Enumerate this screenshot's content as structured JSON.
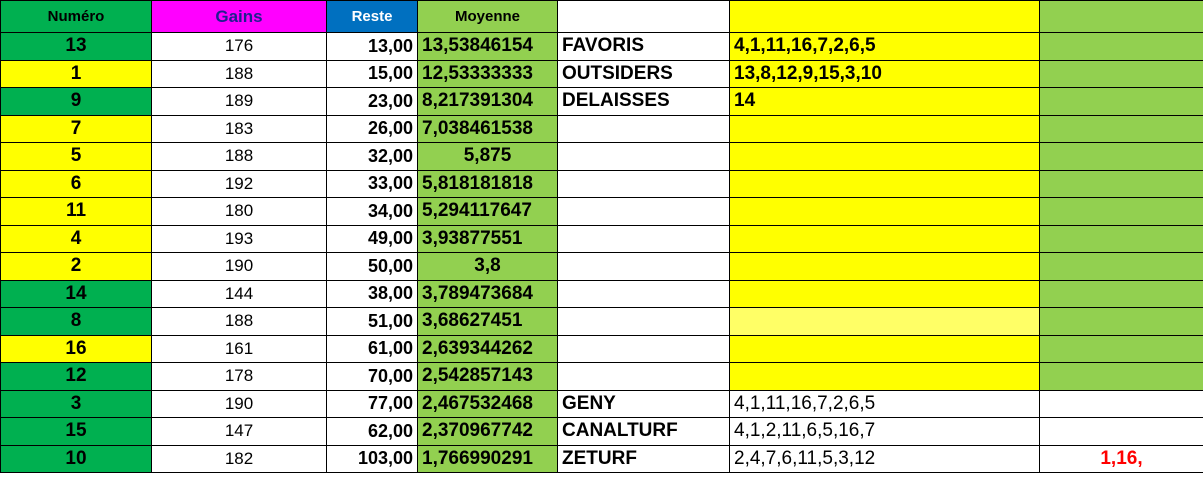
{
  "headers": {
    "numero": "Numéro",
    "gains": "Gains",
    "reste": "Reste",
    "moyenne": "Moyenne"
  },
  "rows": [
    {
      "numero": "13",
      "gains": "176",
      "reste": "13,00",
      "moyenne": "13,53846154",
      "label": "FAVORIS",
      "value": "4,1,11,16,7,2,6,5",
      "last": ""
    },
    {
      "numero": "1",
      "gains": "188",
      "reste": "15,00",
      "moyenne": "12,53333333",
      "label": "OUTSIDERS",
      "value": "13,8,12,9,15,3,10",
      "last": ""
    },
    {
      "numero": "9",
      "gains": "189",
      "reste": "23,00",
      "moyenne": "8,217391304",
      "label": "DELAISSES",
      "value": "14",
      "last": ""
    },
    {
      "numero": "7",
      "gains": "183",
      "reste": "26,00",
      "moyenne": "7,038461538",
      "label": "",
      "value": "",
      "last": ""
    },
    {
      "numero": "5",
      "gains": "188",
      "reste": "32,00",
      "moyenne": "5,875",
      "label": "",
      "value": "",
      "last": ""
    },
    {
      "numero": "6",
      "gains": "192",
      "reste": "33,00",
      "moyenne": "5,818181818",
      "label": "",
      "value": "",
      "last": ""
    },
    {
      "numero": "11",
      "gains": "180",
      "reste": "34,00",
      "moyenne": "5,294117647",
      "label": "",
      "value": "",
      "last": ""
    },
    {
      "numero": "4",
      "gains": "193",
      "reste": "49,00",
      "moyenne": "3,93877551",
      "label": "",
      "value": "",
      "last": ""
    },
    {
      "numero": "2",
      "gains": "190",
      "reste": "50,00",
      "moyenne": "3,8",
      "label": "",
      "value": "",
      "last": ""
    },
    {
      "numero": "14",
      "gains": "144",
      "reste": "38,00",
      "moyenne": "3,789473684",
      "label": "",
      "value": "",
      "last": ""
    },
    {
      "numero": "8",
      "gains": "188",
      "reste": "51,00",
      "moyenne": "3,68627451",
      "label": "",
      "value": "",
      "last": ""
    },
    {
      "numero": "16",
      "gains": "161",
      "reste": "61,00",
      "moyenne": "2,639344262",
      "label": "",
      "value": "",
      "last": ""
    },
    {
      "numero": "12",
      "gains": "178",
      "reste": "70,00",
      "moyenne": "2,542857143",
      "label": "",
      "value": "",
      "last": ""
    },
    {
      "numero": "3",
      "gains": "190",
      "reste": "77,00",
      "moyenne": "2,467532468",
      "label": "GENY",
      "value": "4,1,11,16,7,2,6,5",
      "last": ""
    },
    {
      "numero": "15",
      "gains": "147",
      "reste": "62,00",
      "moyenne": "2,370967742",
      "label": "CANALTURF",
      "value": "4,1,2,11,6,5,16,7",
      "last": ""
    },
    {
      "numero": "10",
      "gains": "182",
      "reste": "103,00",
      "moyenne": "1,766990291",
      "label": "ZETURF",
      "value": "2,4,7,6,11,5,3,12",
      "last": "1,16,"
    }
  ],
  "colors": {
    "green": "#00b050",
    "yellow": "#ffff00",
    "light_green": "#92d050",
    "magenta": "#ff00ff",
    "blue": "#0070c0",
    "red_text": "#ff0000"
  }
}
